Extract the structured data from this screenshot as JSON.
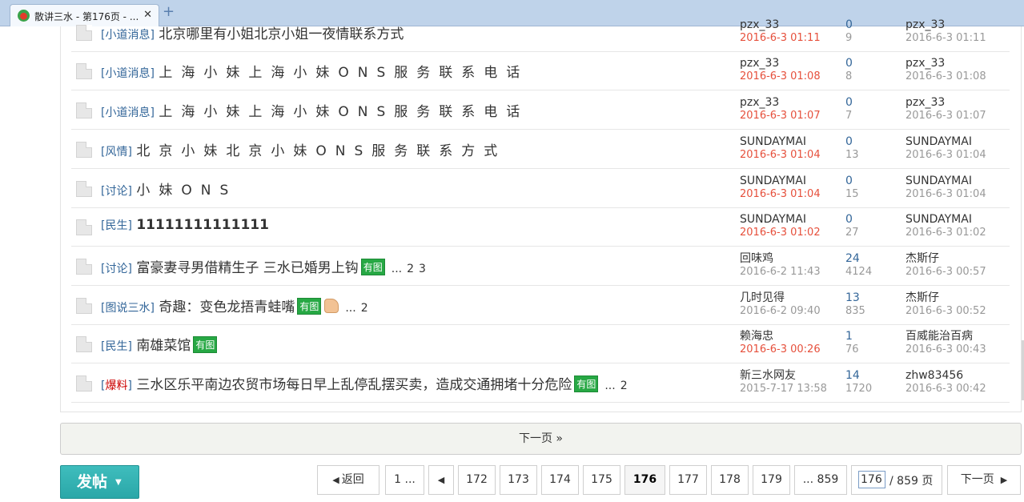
{
  "browser": {
    "tab_title": "散讲三水 - 第176页 - ...",
    "close_glyph": "✕",
    "new_tab_glyph": "+"
  },
  "threads": [
    {
      "category": "小道消息",
      "category_red": false,
      "subject": "北京哪里有小姐北京小姐一夜情联系方式",
      "style": "normal",
      "badge": "",
      "thumb": false,
      "pages": [],
      "author": "pzx_33",
      "post_time": "2016-6-3 01:11",
      "post_time_new": true,
      "replies": "0",
      "views": "9",
      "last_poster": "pzx_33",
      "last_time": "2016-6-3 01:11"
    },
    {
      "category": "小道消息",
      "category_red": false,
      "subject": "上海小妹上海小妹ONS服务联系电话",
      "style": "spaced",
      "badge": "",
      "thumb": false,
      "pages": [],
      "author": "pzx_33",
      "post_time": "2016-6-3 01:08",
      "post_time_new": true,
      "replies": "0",
      "views": "8",
      "last_poster": "pzx_33",
      "last_time": "2016-6-3 01:08"
    },
    {
      "category": "小道消息",
      "category_red": false,
      "subject": "上海小妹上海小妹ONS服务联系电话",
      "style": "spaced",
      "badge": "",
      "thumb": false,
      "pages": [],
      "author": "pzx_33",
      "post_time": "2016-6-3 01:07",
      "post_time_new": true,
      "replies": "0",
      "views": "7",
      "last_poster": "pzx_33",
      "last_time": "2016-6-3 01:07"
    },
    {
      "category": "风情",
      "category_red": false,
      "subject": "北京小妹北京小妹ONS服务联系方式",
      "style": "spaced",
      "badge": "",
      "thumb": false,
      "pages": [],
      "author": "SUNDAYMAI",
      "post_time": "2016-6-3 01:04",
      "post_time_new": true,
      "replies": "0",
      "views": "13",
      "last_poster": "SUNDAYMAI",
      "last_time": "2016-6-3 01:04"
    },
    {
      "category": "讨论",
      "category_red": false,
      "subject": " 小妹ONS",
      "style": "spaced",
      "badge": "",
      "thumb": false,
      "pages": [],
      "author": "SUNDAYMAI",
      "post_time": "2016-6-3 01:04",
      "post_time_new": true,
      "replies": "0",
      "views": "15",
      "last_poster": "SUNDAYMAI",
      "last_time": "2016-6-3 01:04"
    },
    {
      "category": "民生",
      "category_red": false,
      "subject": "11111111111111",
      "style": "bold",
      "badge": "",
      "thumb": false,
      "pages": [],
      "author": "SUNDAYMAI",
      "post_time": "2016-6-3 01:02",
      "post_time_new": true,
      "replies": "0",
      "views": "27",
      "last_poster": "SUNDAYMAI",
      "last_time": "2016-6-3 01:02"
    },
    {
      "category": "讨论",
      "category_red": false,
      "subject": "富豪妻寻男借精生子 三水已婚男上钩",
      "style": "normal",
      "badge": "有图",
      "thumb": false,
      "pages": [
        "2",
        "3"
      ],
      "author": "回味鸡",
      "post_time": "2016-6-2 11:43",
      "post_time_new": false,
      "replies": "24",
      "views": "4124",
      "last_poster": "杰斯仔",
      "last_time": "2016-6-3 00:57"
    },
    {
      "category": "图说三水",
      "category_red": false,
      "subject": "奇趣：变色龙捂青蛙嘴",
      "style": "normal",
      "badge": "有图",
      "thumb": true,
      "pages": [
        "2"
      ],
      "author": "几时见得",
      "post_time": "2016-6-2 09:40",
      "post_time_new": false,
      "replies": "13",
      "views": "835",
      "last_poster": "杰斯仔",
      "last_time": "2016-6-3 00:52"
    },
    {
      "category": "民生",
      "category_red": false,
      "subject": "南雄菜馆",
      "style": "normal",
      "badge": "有图",
      "thumb": false,
      "pages": [],
      "author": "赖海忠",
      "post_time": "2016-6-3 00:26",
      "post_time_new": true,
      "replies": "1",
      "views": "76",
      "last_poster": "百威能治百病",
      "last_time": "2016-6-3 00:43"
    },
    {
      "category": "爆料",
      "category_red": true,
      "subject": "三水区乐平南边农贸市场每日早上乱停乱摆买卖，造成交通拥堵十分危险",
      "style": "normal",
      "badge": "有图",
      "thumb": false,
      "pages": [
        "2"
      ],
      "author": "新三水网友",
      "post_time": "2015-7-17 13:58",
      "post_time_new": false,
      "replies": "14",
      "views": "1720",
      "last_poster": "zhw83456",
      "last_time": "2016-6-3 00:42"
    }
  ],
  "pages_ellipsis": "...",
  "next_bar": "下一页 »",
  "post_button": {
    "label": "发帖",
    "caret": "▼"
  },
  "pager": {
    "back": "返回",
    "first": "1 ...",
    "prev_glyph": "◀",
    "pages": [
      "172",
      "173",
      "174",
      "175",
      "176",
      "177",
      "178",
      "179"
    ],
    "current": "176",
    "last": "... 859",
    "input_value": "176",
    "total": "/ 859 页",
    "next": "下一页",
    "next_glyph": "▶"
  }
}
